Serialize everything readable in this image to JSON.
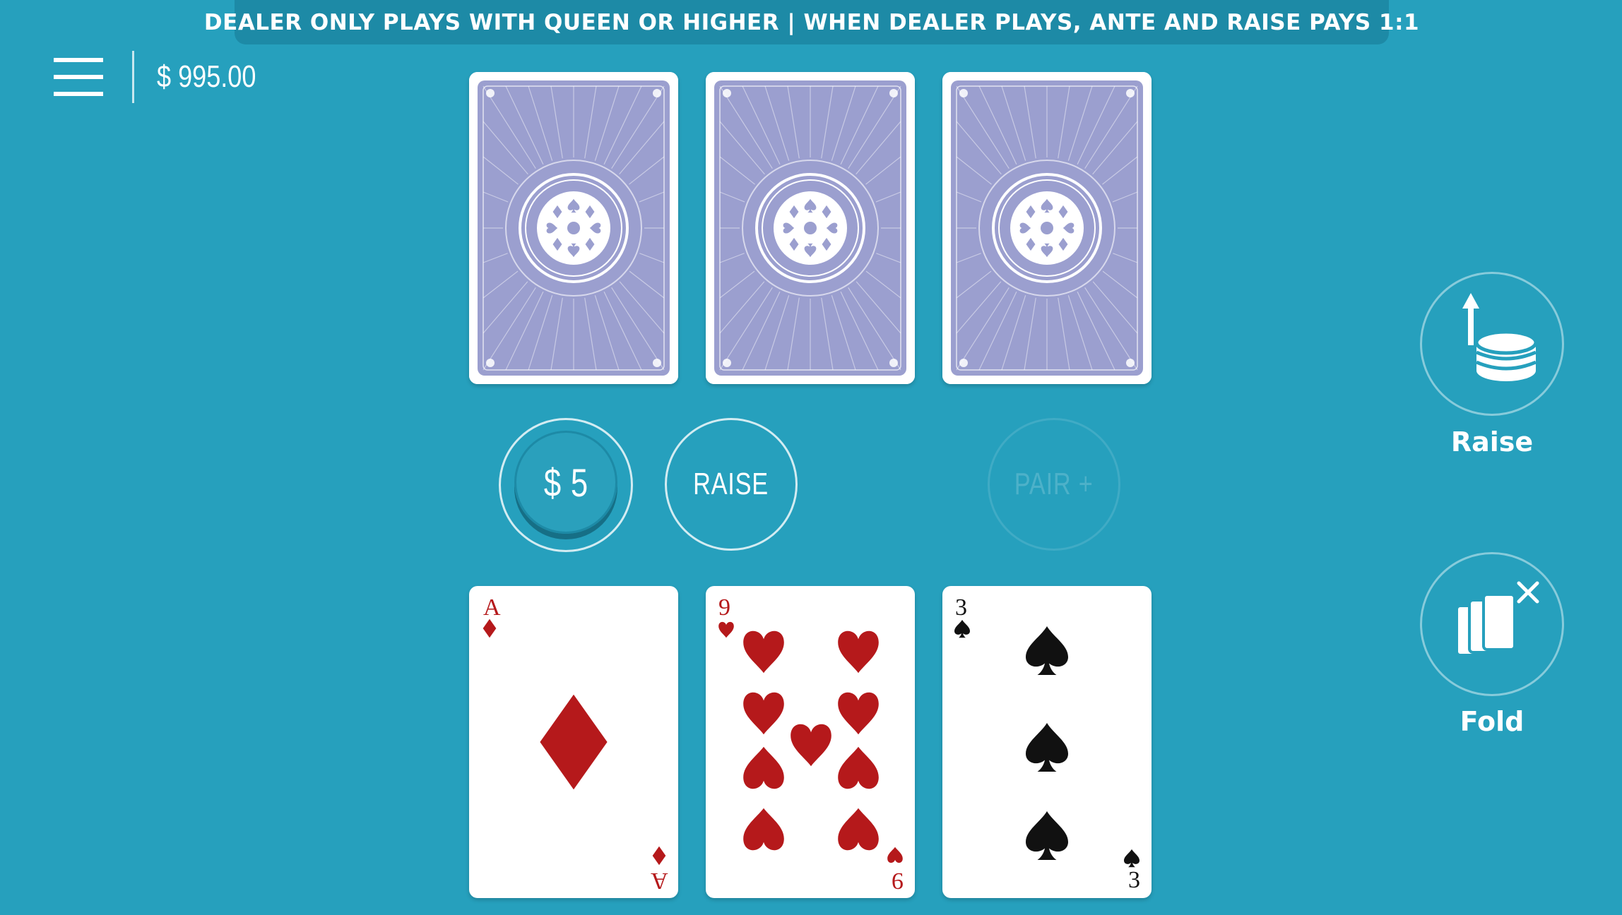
{
  "banner": {
    "text": "DEALER ONLY PLAYS WITH QUEEN OR HIGHER | WHEN DEALER PLAYS, ANTE AND RAISE PAYS 1:1"
  },
  "header": {
    "menu_icon": "hamburger-menu-icon",
    "balance": "$ 995.00"
  },
  "dealer": {
    "cards": [
      "face-down",
      "face-down",
      "face-down"
    ]
  },
  "bets": {
    "ante_chip": "$ 5",
    "raise_spot": "RAISE",
    "pair_plus_spot": "PAIR +"
  },
  "player": {
    "cards": [
      {
        "rank": "A",
        "suit": "diamonds",
        "color": "#b5191b"
      },
      {
        "rank": "9",
        "suit": "hearts",
        "color": "#b5191b"
      },
      {
        "rank": "3",
        "suit": "spades",
        "color": "#111111"
      }
    ]
  },
  "actions": {
    "raise": {
      "label": "Raise",
      "icon": "raise-chips-icon"
    },
    "fold": {
      "label": "Fold",
      "icon": "fold-cards-icon"
    }
  },
  "colors": {
    "table": "#26a0bd",
    "banner": "#1d8aa6",
    "card_back": "#9b9fcf",
    "red_suit": "#b5191b"
  }
}
